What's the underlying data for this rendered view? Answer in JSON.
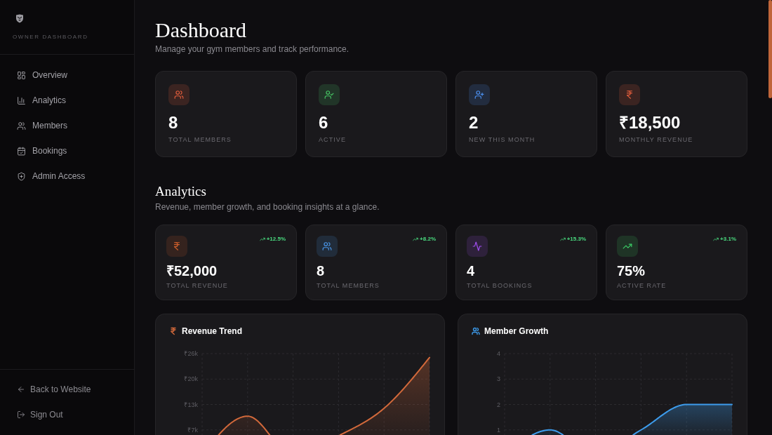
{
  "sidebar": {
    "title": "OWNER DASHBOARD",
    "nav": [
      "Overview",
      "Analytics",
      "Members",
      "Bookings",
      "Admin Access"
    ],
    "footer": [
      "Back to Website",
      "Sign Out"
    ]
  },
  "header": {
    "title": "Dashboard",
    "subtitle": "Manage your gym members and track performance."
  },
  "stats": [
    {
      "value": "8",
      "label": "TOTAL MEMBERS",
      "color": "#e35d3c"
    },
    {
      "value": "6",
      "label": "ACTIVE",
      "color": "#46c463"
    },
    {
      "value": "2",
      "label": "NEW THIS MONTH",
      "color": "#4b8ff0"
    },
    {
      "value": "₹18,500",
      "label": "MONTHLY REVENUE",
      "color": "#e35d3c"
    }
  ],
  "analytics": {
    "title": "Analytics",
    "subtitle": "Revenue, member growth, and booking insights at a glance.",
    "cards": [
      {
        "value": "₹52,000",
        "label": "TOTAL REVENUE",
        "change": "+12.5%",
        "color": "#d2602c"
      },
      {
        "value": "8",
        "label": "TOTAL MEMBERS",
        "change": "+8.2%",
        "color": "#4a97ea"
      },
      {
        "value": "4",
        "label": "TOTAL BOOKINGS",
        "change": "+15.3%",
        "color": "#a24ef2"
      },
      {
        "value": "75%",
        "label": "ACTIVE RATE",
        "change": "+3.1%",
        "color": "#3ccf67"
      }
    ],
    "charts": [
      {
        "title": "Revenue Trend",
        "y_labels": [
          "₹26k",
          "₹20k",
          "₹13k",
          "₹7k"
        ],
        "color": "#d2693b"
      },
      {
        "title": "Member Growth",
        "y_labels": [
          "4",
          "3",
          "2",
          "1"
        ],
        "color": "#3d9cec"
      }
    ]
  }
}
